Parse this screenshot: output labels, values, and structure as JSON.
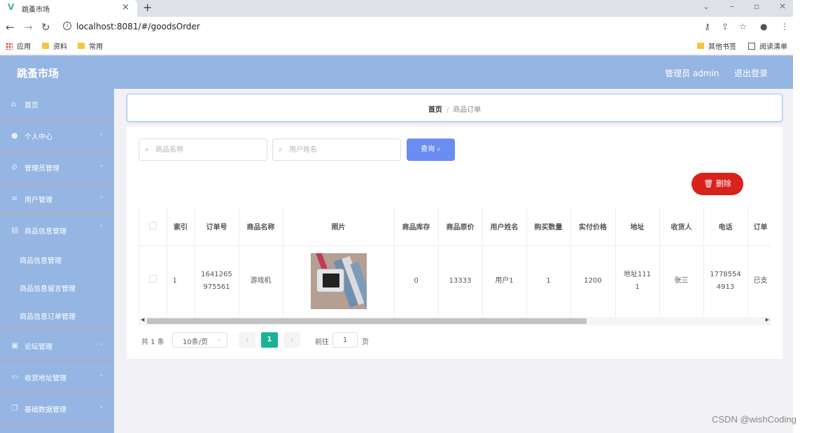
{
  "browser": {
    "tab_title": "跳蚤市场",
    "url": "localhost:8081/#/goodsOrder",
    "bookmarks": [
      "应用",
      "资料",
      "常用"
    ],
    "bookmarks_right": [
      "其他书签",
      "阅读清单"
    ]
  },
  "header": {
    "brand": "跳蚤市场",
    "admin": "管理员 admin",
    "logout": "退出登录"
  },
  "sidebar": {
    "items": [
      {
        "label": "首页",
        "icon": "home-icon"
      },
      {
        "label": "个人中心",
        "icon": "user-icon"
      },
      {
        "label": "管理员管理",
        "icon": "admin-icon"
      },
      {
        "label": "用户管理",
        "icon": "menu-icon"
      },
      {
        "label": "商品信息管理",
        "icon": "document-icon"
      }
    ],
    "subitems": [
      "商品信息管理",
      "商品信息留言管理",
      "商品信息订单管理"
    ],
    "items_after": [
      {
        "label": "论坛管理",
        "icon": "forum-icon"
      },
      {
        "label": "收货地址管理",
        "icon": "address-icon"
      },
      {
        "label": "基础数据管理",
        "icon": "data-icon"
      }
    ]
  },
  "breadcrumb": {
    "home": "首页",
    "separator": "/",
    "current": "商品订单"
  },
  "search": {
    "goods_placeholder": "商品名称",
    "user_placeholder": "用户姓名",
    "query_label": "查询"
  },
  "actions": {
    "delete_label": "删除"
  },
  "table": {
    "columns": [
      "索引",
      "订单号",
      "商品名称",
      "照片",
      "商品库存",
      "商品原价",
      "用户姓名",
      "购买数量",
      "实付价格",
      "地址",
      "收货人",
      "电话",
      "订单"
    ],
    "rows": [
      {
        "index": "1",
        "order_no_l1": "1641265",
        "order_no_l2": "975561",
        "goods_name": "游戏机",
        "stock": "0",
        "original_price": "13333",
        "user_name": "用户1",
        "quantity": "1",
        "paid_price": "1200",
        "address_l1": "地址111",
        "address_l2": "1",
        "receiver": "张三",
        "phone_l1": "1778554",
        "phone_l2": "4913",
        "status": "已支"
      }
    ]
  },
  "pagination": {
    "total": "共 1 条",
    "page_size": "10条/页",
    "current_page": "1",
    "goto_label": "前往",
    "goto_value": "1",
    "page_suffix": "页"
  },
  "watermark": "CSDN @wishCoding",
  "colors": {
    "sidebar": "#95b5e3",
    "primary_button": "#6b8cf0",
    "danger_button": "#d9221c",
    "active_page": "#19b394"
  }
}
